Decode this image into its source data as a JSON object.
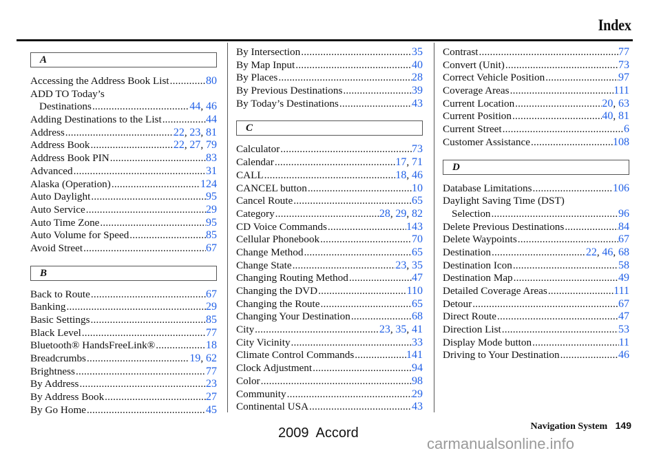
{
  "header": {
    "title": "Index"
  },
  "colors": {
    "link": "#1f5fe6",
    "text": "#111111",
    "watermark": "#9a9a9a"
  },
  "columns": [
    {
      "blocks": [
        {
          "letter": "A",
          "entries": [
            {
              "label": "Accessing the Address Book List",
              "pages": [
                "80"
              ]
            },
            {
              "label": "ADD TO Today’s",
              "pages": [],
              "continued": true
            },
            {
              "label": "Destinations",
              "pages": [
                "44",
                "46"
              ],
              "indent": true
            },
            {
              "label": "Adding Destinations to the List",
              "pages": [
                "44"
              ]
            },
            {
              "label": "Address",
              "pages": [
                "22",
                "23",
                "81"
              ]
            },
            {
              "label": "Address Book",
              "pages": [
                "22",
                "27",
                "79"
              ]
            },
            {
              "label": "Address Book PIN",
              "pages": [
                "83"
              ]
            },
            {
              "label": "Advanced",
              "pages": [
                "31"
              ]
            },
            {
              "label": "Alaska (Operation)",
              "pages": [
                "124"
              ]
            },
            {
              "label": "Auto Daylight",
              "pages": [
                "95"
              ]
            },
            {
              "label": "Auto Service",
              "pages": [
                "29"
              ]
            },
            {
              "label": "Auto Time Zone",
              "pages": [
                "95"
              ]
            },
            {
              "label": "Auto Volume for Speed",
              "pages": [
                "85"
              ]
            },
            {
              "label": "Avoid Street",
              "pages": [
                "67"
              ]
            }
          ]
        },
        {
          "letter": "B",
          "entries": [
            {
              "label": "Back to Route",
              "pages": [
                "67"
              ]
            },
            {
              "label": "Banking",
              "pages": [
                "29"
              ]
            },
            {
              "label": "Basic Settings",
              "pages": [
                "85"
              ]
            },
            {
              "label": "Black Level",
              "pages": [
                "77"
              ]
            },
            {
              "label": "Bluetooth® HandsFreeLink®",
              "pages": [
                "18"
              ]
            },
            {
              "label": "Breadcrumbs",
              "pages": [
                "19",
                "62"
              ]
            },
            {
              "label": "Brightness",
              "pages": [
                "77"
              ]
            },
            {
              "label": "By Address",
              "pages": [
                "23"
              ]
            },
            {
              "label": "By Address Book",
              "pages": [
                "27"
              ]
            },
            {
              "label": "By Go Home",
              "pages": [
                "45"
              ]
            }
          ]
        }
      ]
    },
    {
      "blocks": [
        {
          "letter": null,
          "entries": [
            {
              "label": "By Intersection",
              "pages": [
                "35"
              ]
            },
            {
              "label": "By Map Input",
              "pages": [
                "40"
              ]
            },
            {
              "label": "By Places",
              "pages": [
                "28"
              ]
            },
            {
              "label": "By Previous Destinations",
              "pages": [
                "39"
              ]
            },
            {
              "label": "By Today’s Destinations",
              "pages": [
                "43"
              ]
            }
          ]
        },
        {
          "letter": "C",
          "entries": [
            {
              "label": "Calculator",
              "pages": [
                "73"
              ]
            },
            {
              "label": "Calendar",
              "pages": [
                "17",
                "71"
              ]
            },
            {
              "label": "CALL",
              "pages": [
                "18",
                "46"
              ]
            },
            {
              "label": "CANCEL button",
              "pages": [
                "10"
              ]
            },
            {
              "label": "Cancel Route",
              "pages": [
                "65"
              ]
            },
            {
              "label": "Category",
              "pages": [
                "28",
                "29",
                "82"
              ]
            },
            {
              "label": "CD Voice Commands",
              "pages": [
                "143"
              ]
            },
            {
              "label": "Cellular Phonebook",
              "pages": [
                "70"
              ]
            },
            {
              "label": "Change Method",
              "pages": [
                "65"
              ]
            },
            {
              "label": "Change State",
              "pages": [
                "23",
                "35"
              ]
            },
            {
              "label": "Changing Routing Method",
              "pages": [
                "47"
              ]
            },
            {
              "label": "Changing the DVD",
              "pages": [
                "110"
              ]
            },
            {
              "label": "Changing the Route",
              "pages": [
                "65"
              ]
            },
            {
              "label": "Changing Your Destination",
              "pages": [
                "68"
              ]
            },
            {
              "label": "City",
              "pages": [
                "23",
                "35",
                "41"
              ]
            },
            {
              "label": "City Vicinity",
              "pages": [
                "33"
              ]
            },
            {
              "label": "Climate Control Commands",
              "pages": [
                "141"
              ]
            },
            {
              "label": "Clock Adjustment",
              "pages": [
                "94"
              ]
            },
            {
              "label": "Color",
              "pages": [
                "98"
              ]
            },
            {
              "label": "Community",
              "pages": [
                "29"
              ]
            },
            {
              "label": "Continental USA",
              "pages": [
                "43"
              ]
            }
          ]
        }
      ]
    },
    {
      "blocks": [
        {
          "letter": null,
          "entries": [
            {
              "label": "Contrast",
              "pages": [
                "77"
              ]
            },
            {
              "label": "Convert (Unit)",
              "pages": [
                "73"
              ]
            },
            {
              "label": "Correct Vehicle Position",
              "pages": [
                "97"
              ]
            },
            {
              "label": "Coverage Areas",
              "pages": [
                "111"
              ]
            },
            {
              "label": "Current Location",
              "pages": [
                "20",
                "63"
              ]
            },
            {
              "label": "Current Position",
              "pages": [
                "40",
                "81"
              ]
            },
            {
              "label": "Current Street",
              "pages": [
                "6"
              ]
            },
            {
              "label": "Customer Assistance",
              "pages": [
                "108"
              ]
            }
          ]
        },
        {
          "letter": "D",
          "entries": [
            {
              "label": "Database Limitations",
              "pages": [
                "106"
              ]
            },
            {
              "label": "Daylight Saving Time (DST)",
              "pages": [],
              "continued": true
            },
            {
              "label": "Selection",
              "pages": [
                "96"
              ],
              "indent": true
            },
            {
              "label": "Delete Previous Destinations",
              "pages": [
                "84"
              ]
            },
            {
              "label": "Delete Waypoints",
              "pages": [
                "67"
              ]
            },
            {
              "label": "Destination",
              "pages": [
                "22",
                "46",
                "68"
              ]
            },
            {
              "label": "Destination Icon",
              "pages": [
                "58"
              ]
            },
            {
              "label": "Destination Map",
              "pages": [
                "49"
              ]
            },
            {
              "label": "Detailed Coverage Areas",
              "pages": [
                "111"
              ]
            },
            {
              "label": "Detour",
              "pages": [
                "67"
              ]
            },
            {
              "label": "Direct Route",
              "pages": [
                "47"
              ]
            },
            {
              "label": "Direction List",
              "pages": [
                "53"
              ]
            },
            {
              "label": "Display Mode button",
              "pages": [
                "11"
              ]
            },
            {
              "label": "Driving to Your Destination",
              "pages": [
                "46"
              ]
            }
          ]
        }
      ]
    }
  ],
  "footer": {
    "section": "Navigation System",
    "page_number": "149",
    "model": "2009  Accord",
    "watermark": "carmanualsonline.info"
  }
}
